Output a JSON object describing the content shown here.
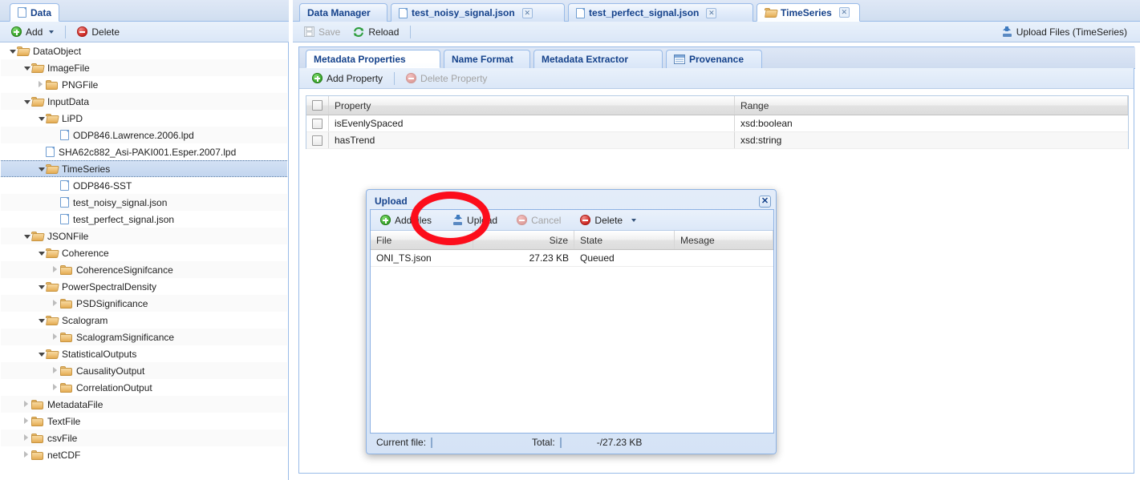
{
  "left_panel": {
    "tab": {
      "label": "Data",
      "icon": "file-icon"
    },
    "toolbar": {
      "add_label": "Add",
      "delete_label": "Delete"
    },
    "tree": [
      {
        "label": "DataObject",
        "depth": 0,
        "type": "folder-open",
        "arrow": "down",
        "selected": false
      },
      {
        "label": "ImageFile",
        "depth": 1,
        "type": "folder-open",
        "arrow": "down",
        "selected": false
      },
      {
        "label": "PNGFile",
        "depth": 2,
        "type": "folder",
        "arrow": "right",
        "selected": false
      },
      {
        "label": "InputData",
        "depth": 1,
        "type": "folder-open",
        "arrow": "down",
        "selected": false
      },
      {
        "label": "LiPD",
        "depth": 2,
        "type": "folder-open",
        "arrow": "down",
        "selected": false
      },
      {
        "label": "ODP846.Lawrence.2006.lpd",
        "depth": 3,
        "type": "file",
        "arrow": "none",
        "selected": false
      },
      {
        "label": "SHA62c882_Asi-PAKI001.Esper.2007.lpd",
        "depth": 2,
        "type": "file",
        "arrow": "none",
        "selected": false
      },
      {
        "label": "TimeSeries",
        "depth": 2,
        "type": "folder-open",
        "arrow": "down",
        "selected": true
      },
      {
        "label": "ODP846-SST",
        "depth": 3,
        "type": "file",
        "arrow": "none",
        "selected": false
      },
      {
        "label": "test_noisy_signal.json",
        "depth": 3,
        "type": "file",
        "arrow": "none",
        "selected": false
      },
      {
        "label": "test_perfect_signal.json",
        "depth": 3,
        "type": "file",
        "arrow": "none",
        "selected": false
      },
      {
        "label": "JSONFile",
        "depth": 1,
        "type": "folder-open",
        "arrow": "down",
        "selected": false
      },
      {
        "label": "Coherence",
        "depth": 2,
        "type": "folder-open",
        "arrow": "down",
        "selected": false
      },
      {
        "label": "CoherenceSignifcance",
        "depth": 3,
        "type": "folder",
        "arrow": "right",
        "selected": false
      },
      {
        "label": "PowerSpectralDensity",
        "depth": 2,
        "type": "folder-open",
        "arrow": "down",
        "selected": false
      },
      {
        "label": "PSDSignificance",
        "depth": 3,
        "type": "folder",
        "arrow": "right",
        "selected": false
      },
      {
        "label": "Scalogram",
        "depth": 2,
        "type": "folder-open",
        "arrow": "down",
        "selected": false
      },
      {
        "label": "ScalogramSignificance",
        "depth": 3,
        "type": "folder",
        "arrow": "right",
        "selected": false
      },
      {
        "label": "StatisticalOutputs",
        "depth": 2,
        "type": "folder-open",
        "arrow": "down",
        "selected": false
      },
      {
        "label": "CausalityOutput",
        "depth": 3,
        "type": "folder",
        "arrow": "right",
        "selected": false
      },
      {
        "label": "CorrelationOutput",
        "depth": 3,
        "type": "folder",
        "arrow": "right",
        "selected": false
      },
      {
        "label": "MetadataFile",
        "depth": 1,
        "type": "folder",
        "arrow": "right",
        "selected": false
      },
      {
        "label": "TextFile",
        "depth": 1,
        "type": "folder",
        "arrow": "right",
        "selected": false
      },
      {
        "label": "csvFile",
        "depth": 1,
        "type": "folder",
        "arrow": "right",
        "selected": false
      },
      {
        "label": "netCDF",
        "depth": 1,
        "type": "folder",
        "arrow": "right",
        "selected": false
      }
    ]
  },
  "right_panel": {
    "tabs": [
      {
        "label": "Data Manager",
        "icon": "none",
        "closable": false,
        "active": false
      },
      {
        "label": "test_noisy_signal.json",
        "icon": "file-icon",
        "closable": true,
        "active": false
      },
      {
        "label": "test_perfect_signal.json",
        "icon": "file-icon",
        "closable": true,
        "active": false
      },
      {
        "label": "TimeSeries",
        "icon": "folder-icon",
        "closable": true,
        "active": true
      }
    ],
    "toolbar": {
      "save_label": "Save",
      "reload_label": "Reload",
      "upload_files_label": "Upload Files (TimeSeries)"
    },
    "inner_tabs": [
      {
        "label": "Metadata Properties",
        "icon": "none",
        "active": true
      },
      {
        "label": "Name Format",
        "icon": "none",
        "active": false
      },
      {
        "label": "Metadata Extractor",
        "icon": "none",
        "active": false
      },
      {
        "label": "Provenance",
        "icon": "grid-icon",
        "active": false
      }
    ],
    "grid_toolbar": {
      "add_property_label": "Add Property",
      "delete_property_label": "Delete Property"
    },
    "property_grid": {
      "columns": [
        "",
        "Property",
        "Range"
      ],
      "rows": [
        {
          "checked": false,
          "property": "isEvenlySpaced",
          "range": "xsd:boolean"
        },
        {
          "checked": false,
          "property": "hasTrend",
          "range": "xsd:string"
        }
      ]
    }
  },
  "upload_dialog": {
    "title": "Upload",
    "close_label": "✕",
    "toolbar": {
      "add_files_label": "Add files",
      "upload_label": "Upload",
      "cancel_label": "Cancel",
      "delete_label": "Delete"
    },
    "columns": [
      "File",
      "Size",
      "State",
      "Mesage"
    ],
    "rows": [
      {
        "file": "ONI_TS.json",
        "size": "27.23 KB",
        "state": "Queued",
        "message": ""
      }
    ],
    "footer": {
      "current_file_label": "Current file:",
      "total_label": "Total:",
      "total_value": "-/27.23 KB"
    }
  },
  "annotation": {
    "shape": "ellipse",
    "color": "#fc0d1b",
    "target": "upload-button"
  }
}
